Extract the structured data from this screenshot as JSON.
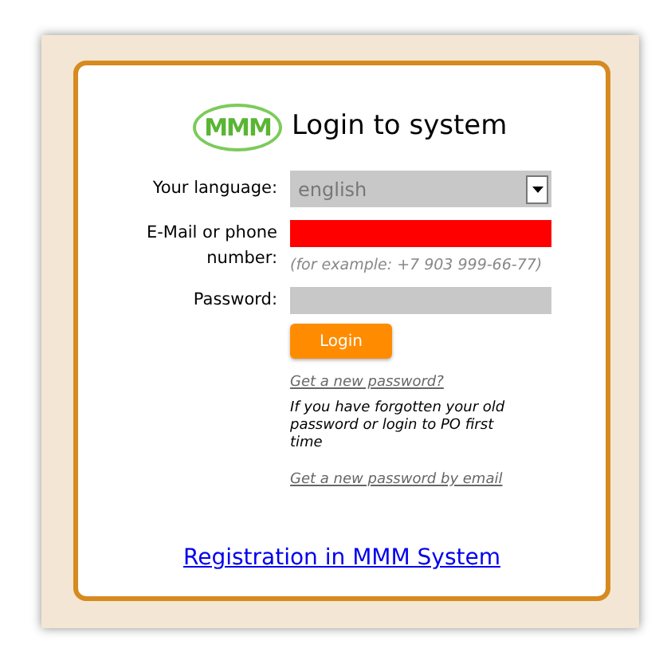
{
  "logo": {
    "text": "MMM"
  },
  "title": "Login to system",
  "language": {
    "label": "Your language:",
    "value": "english"
  },
  "email": {
    "label": "E-Mail or phone number:",
    "invalid": true,
    "hint": "(for example: +7 903 999-66-77)"
  },
  "password": {
    "label": "Password:"
  },
  "login_button": "Login",
  "forgot_link": "Get a new password?",
  "forgot_note": "If you have forgotten your old password or login to PO first time",
  "email_link": "Get a new password by email",
  "registration_link": "Registration in MMM System"
}
